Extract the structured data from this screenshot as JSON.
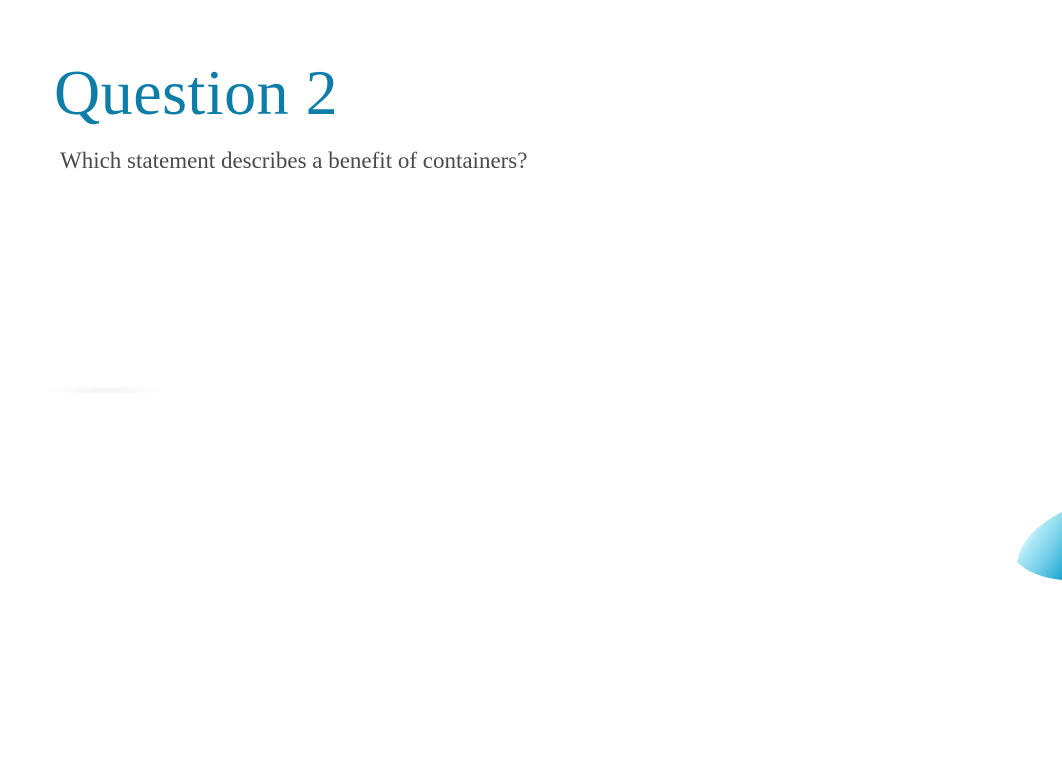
{
  "heading": "Question 2",
  "body": "Which statement describes a benefit of containers?",
  "colors": {
    "heading": "#0e7da8",
    "body": "#4a4a4a",
    "accent_gradient_start": "#00b4d8",
    "accent_gradient_end": "#ffffff"
  }
}
